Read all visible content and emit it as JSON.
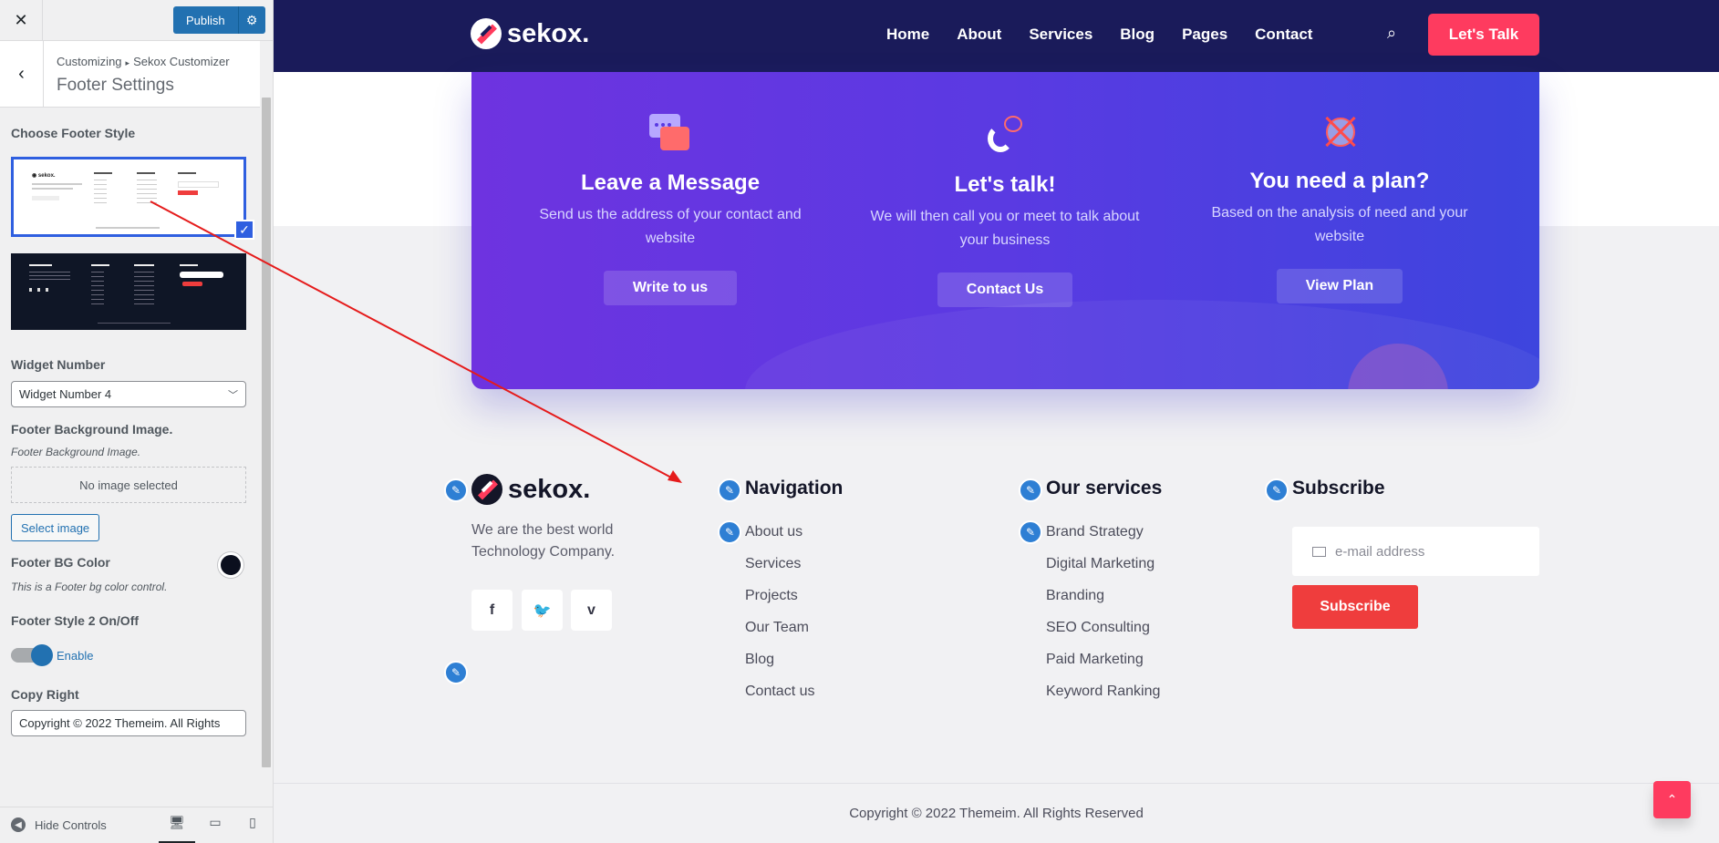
{
  "sidebar": {
    "close": "✕",
    "publish": "Publish",
    "crumb1": "Customizing",
    "crumb2": "Sekox Customizer",
    "section": "Footer Settings",
    "choose_style": "Choose Footer Style",
    "widget_number_label": "Widget Number",
    "widget_number_value": "Widget Number 4",
    "bg_image_label": "Footer Background Image.",
    "bg_image_desc": "Footer Background Image.",
    "no_image": "No image selected",
    "select_image": "Select image",
    "bg_color_label": "Footer BG Color",
    "bg_color_desc": "This is a Footer bg color control.",
    "bg_color_value": "#0b0f1e",
    "style2_label": "Footer Style 2 On/Off",
    "style2_value": "Enable",
    "copyright_label": "Copy Right",
    "copyright_value": "Copyright © 2022 Themeim. All Rights",
    "hide_controls": "Hide Controls"
  },
  "site": {
    "brand": "sekox.",
    "menu": [
      "Home",
      "About",
      "Services",
      "Blog",
      "Pages",
      "Contact"
    ],
    "cta": "Let's Talk",
    "cards": [
      {
        "title": "Leave a Message",
        "text": "Send us the address of your contact and website",
        "button": "Write to us"
      },
      {
        "title": "Let's talk!",
        "text": "We will then call you or meet to talk about your business",
        "button": "Contact Us"
      },
      {
        "title": "You need a plan?",
        "text": "Based on the analysis of need and your website",
        "button": "View Plan"
      }
    ],
    "footer": {
      "desc": "We are the best world Technology Company.",
      "social": [
        "f",
        "🐦",
        "v"
      ],
      "nav_title": "Navigation",
      "nav": [
        "About us",
        "Services",
        "Projects",
        "Our Team",
        "Blog",
        "Contact us"
      ],
      "svc_title": "Our services",
      "svc": [
        "Brand Strategy",
        "Digital Marketing",
        "Branding",
        "SEO Consulting",
        "Paid Marketing",
        "Keyword Ranking"
      ],
      "sub_title": "Subscribe",
      "email_placeholder": "e-mail address",
      "sub_button": "Subscribe",
      "copyright": "Copyright © 2022 Themeim. All Rights Reserved"
    }
  },
  "colors": {
    "nav_bg": "#1a1b5a",
    "cta": "#fe3b5f",
    "accent": "#2271b1",
    "subscribe": "#ef3d3d"
  }
}
